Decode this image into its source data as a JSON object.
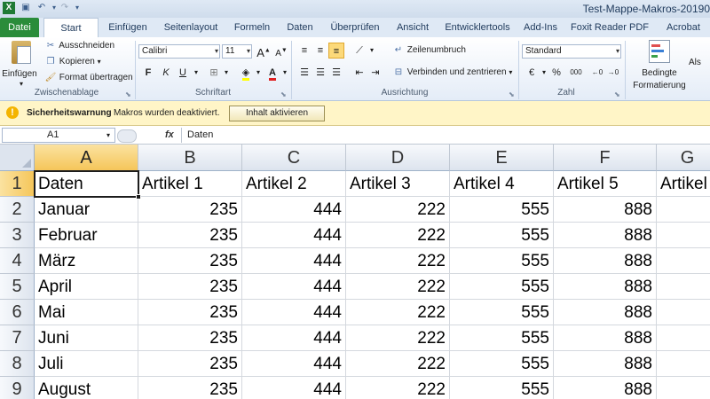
{
  "window": {
    "title": "Test-Mappe-Makros-20190"
  },
  "tabs": [
    "Datei",
    "Start",
    "Einfügen",
    "Seitenlayout",
    "Formeln",
    "Daten",
    "Überprüfen",
    "Ansicht",
    "Entwicklertools",
    "Add-Ins",
    "Foxit Reader PDF",
    "Acrobat"
  ],
  "ribbon": {
    "clipboard": {
      "paste": "Einfügen",
      "cut": "Ausschneiden",
      "copy": "Kopieren",
      "format_painter": "Format übertragen",
      "label": "Zwischenablage"
    },
    "font": {
      "name": "Calibri",
      "size": "11",
      "bold": "F",
      "italic": "K",
      "underline": "U",
      "label": "Schriftart"
    },
    "alignment": {
      "wrap": "Zeilenumbruch",
      "merge": "Verbinden und zentrieren",
      "label": "Ausrichtung"
    },
    "number": {
      "format": "Standard",
      "currency": "€",
      "percent": "%",
      "thousands": "000",
      "label": "Zahl"
    },
    "styles": {
      "cond_format_line1": "Bedingte",
      "cond_format_line2": "Formatierung",
      "as_table": "Als"
    }
  },
  "security_bar": {
    "title": "Sicherheitswarnung",
    "message": "Makros wurden deaktiviert.",
    "button": "Inhalt aktivieren"
  },
  "formula_bar": {
    "name_box": "A1",
    "fx": "fx",
    "content": "Daten"
  },
  "grid": {
    "columns": [
      "A",
      "B",
      "C",
      "D",
      "E",
      "F",
      "G"
    ],
    "rows": [
      "1",
      "2",
      "3",
      "4",
      "5",
      "6",
      "7",
      "8",
      "9"
    ],
    "selected_cell": "A1",
    "header_row": [
      "Daten",
      "Artikel 1",
      "Artikel 2",
      "Artikel 3",
      "Artikel 4",
      "Artikel 5",
      "Artikel"
    ],
    "data_rows": [
      [
        "Januar",
        "235",
        "444",
        "222",
        "555",
        "888"
      ],
      [
        "Februar",
        "235",
        "444",
        "222",
        "555",
        "888"
      ],
      [
        "März",
        "235",
        "444",
        "222",
        "555",
        "888"
      ],
      [
        "April",
        "235",
        "444",
        "222",
        "555",
        "888"
      ],
      [
        "Mai",
        "235",
        "444",
        "222",
        "555",
        "888"
      ],
      [
        "Juni",
        "235",
        "444",
        "222",
        "555",
        "888"
      ],
      [
        "Juli",
        "235",
        "444",
        "222",
        "555",
        "888"
      ],
      [
        "August",
        "235",
        "444",
        "222",
        "555",
        "888"
      ]
    ]
  }
}
